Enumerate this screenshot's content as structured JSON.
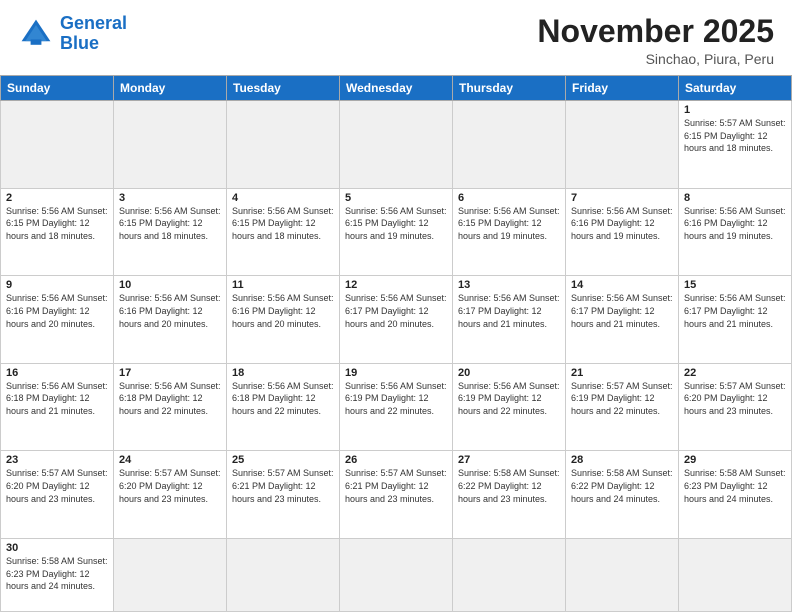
{
  "header": {
    "logo_general": "General",
    "logo_blue": "Blue",
    "title": "November 2025",
    "subtitle": "Sinchao, Piura, Peru"
  },
  "weekdays": [
    "Sunday",
    "Monday",
    "Tuesday",
    "Wednesday",
    "Thursday",
    "Friday",
    "Saturday"
  ],
  "weeks": [
    [
      {
        "day": "",
        "info": "",
        "empty": true
      },
      {
        "day": "",
        "info": "",
        "empty": true
      },
      {
        "day": "",
        "info": "",
        "empty": true
      },
      {
        "day": "",
        "info": "",
        "empty": true
      },
      {
        "day": "",
        "info": "",
        "empty": true
      },
      {
        "day": "",
        "info": "",
        "empty": true
      },
      {
        "day": "1",
        "info": "Sunrise: 5:57 AM\nSunset: 6:15 PM\nDaylight: 12 hours\nand 18 minutes."
      }
    ],
    [
      {
        "day": "2",
        "info": "Sunrise: 5:56 AM\nSunset: 6:15 PM\nDaylight: 12 hours\nand 18 minutes."
      },
      {
        "day": "3",
        "info": "Sunrise: 5:56 AM\nSunset: 6:15 PM\nDaylight: 12 hours\nand 18 minutes."
      },
      {
        "day": "4",
        "info": "Sunrise: 5:56 AM\nSunset: 6:15 PM\nDaylight: 12 hours\nand 18 minutes."
      },
      {
        "day": "5",
        "info": "Sunrise: 5:56 AM\nSunset: 6:15 PM\nDaylight: 12 hours\nand 19 minutes."
      },
      {
        "day": "6",
        "info": "Sunrise: 5:56 AM\nSunset: 6:15 PM\nDaylight: 12 hours\nand 19 minutes."
      },
      {
        "day": "7",
        "info": "Sunrise: 5:56 AM\nSunset: 6:16 PM\nDaylight: 12 hours\nand 19 minutes."
      },
      {
        "day": "8",
        "info": "Sunrise: 5:56 AM\nSunset: 6:16 PM\nDaylight: 12 hours\nand 19 minutes."
      }
    ],
    [
      {
        "day": "9",
        "info": "Sunrise: 5:56 AM\nSunset: 6:16 PM\nDaylight: 12 hours\nand 20 minutes."
      },
      {
        "day": "10",
        "info": "Sunrise: 5:56 AM\nSunset: 6:16 PM\nDaylight: 12 hours\nand 20 minutes."
      },
      {
        "day": "11",
        "info": "Sunrise: 5:56 AM\nSunset: 6:16 PM\nDaylight: 12 hours\nand 20 minutes."
      },
      {
        "day": "12",
        "info": "Sunrise: 5:56 AM\nSunset: 6:17 PM\nDaylight: 12 hours\nand 20 minutes."
      },
      {
        "day": "13",
        "info": "Sunrise: 5:56 AM\nSunset: 6:17 PM\nDaylight: 12 hours\nand 21 minutes."
      },
      {
        "day": "14",
        "info": "Sunrise: 5:56 AM\nSunset: 6:17 PM\nDaylight: 12 hours\nand 21 minutes."
      },
      {
        "day": "15",
        "info": "Sunrise: 5:56 AM\nSunset: 6:17 PM\nDaylight: 12 hours\nand 21 minutes."
      }
    ],
    [
      {
        "day": "16",
        "info": "Sunrise: 5:56 AM\nSunset: 6:18 PM\nDaylight: 12 hours\nand 21 minutes."
      },
      {
        "day": "17",
        "info": "Sunrise: 5:56 AM\nSunset: 6:18 PM\nDaylight: 12 hours\nand 22 minutes."
      },
      {
        "day": "18",
        "info": "Sunrise: 5:56 AM\nSunset: 6:18 PM\nDaylight: 12 hours\nand 22 minutes."
      },
      {
        "day": "19",
        "info": "Sunrise: 5:56 AM\nSunset: 6:19 PM\nDaylight: 12 hours\nand 22 minutes."
      },
      {
        "day": "20",
        "info": "Sunrise: 5:56 AM\nSunset: 6:19 PM\nDaylight: 12 hours\nand 22 minutes."
      },
      {
        "day": "21",
        "info": "Sunrise: 5:57 AM\nSunset: 6:19 PM\nDaylight: 12 hours\nand 22 minutes."
      },
      {
        "day": "22",
        "info": "Sunrise: 5:57 AM\nSunset: 6:20 PM\nDaylight: 12 hours\nand 23 minutes."
      }
    ],
    [
      {
        "day": "23",
        "info": "Sunrise: 5:57 AM\nSunset: 6:20 PM\nDaylight: 12 hours\nand 23 minutes."
      },
      {
        "day": "24",
        "info": "Sunrise: 5:57 AM\nSunset: 6:20 PM\nDaylight: 12 hours\nand 23 minutes."
      },
      {
        "day": "25",
        "info": "Sunrise: 5:57 AM\nSunset: 6:21 PM\nDaylight: 12 hours\nand 23 minutes."
      },
      {
        "day": "26",
        "info": "Sunrise: 5:57 AM\nSunset: 6:21 PM\nDaylight: 12 hours\nand 23 minutes."
      },
      {
        "day": "27",
        "info": "Sunrise: 5:58 AM\nSunset: 6:22 PM\nDaylight: 12 hours\nand 23 minutes."
      },
      {
        "day": "28",
        "info": "Sunrise: 5:58 AM\nSunset: 6:22 PM\nDaylight: 12 hours\nand 24 minutes."
      },
      {
        "day": "29",
        "info": "Sunrise: 5:58 AM\nSunset: 6:23 PM\nDaylight: 12 hours\nand 24 minutes."
      }
    ],
    [
      {
        "day": "30",
        "info": "Sunrise: 5:58 AM\nSunset: 6:23 PM\nDaylight: 12 hours\nand 24 minutes."
      },
      {
        "day": "",
        "info": "",
        "empty": true
      },
      {
        "day": "",
        "info": "",
        "empty": true
      },
      {
        "day": "",
        "info": "",
        "empty": true
      },
      {
        "day": "",
        "info": "",
        "empty": true
      },
      {
        "day": "",
        "info": "",
        "empty": true
      },
      {
        "day": "",
        "info": "",
        "empty": true
      }
    ]
  ]
}
